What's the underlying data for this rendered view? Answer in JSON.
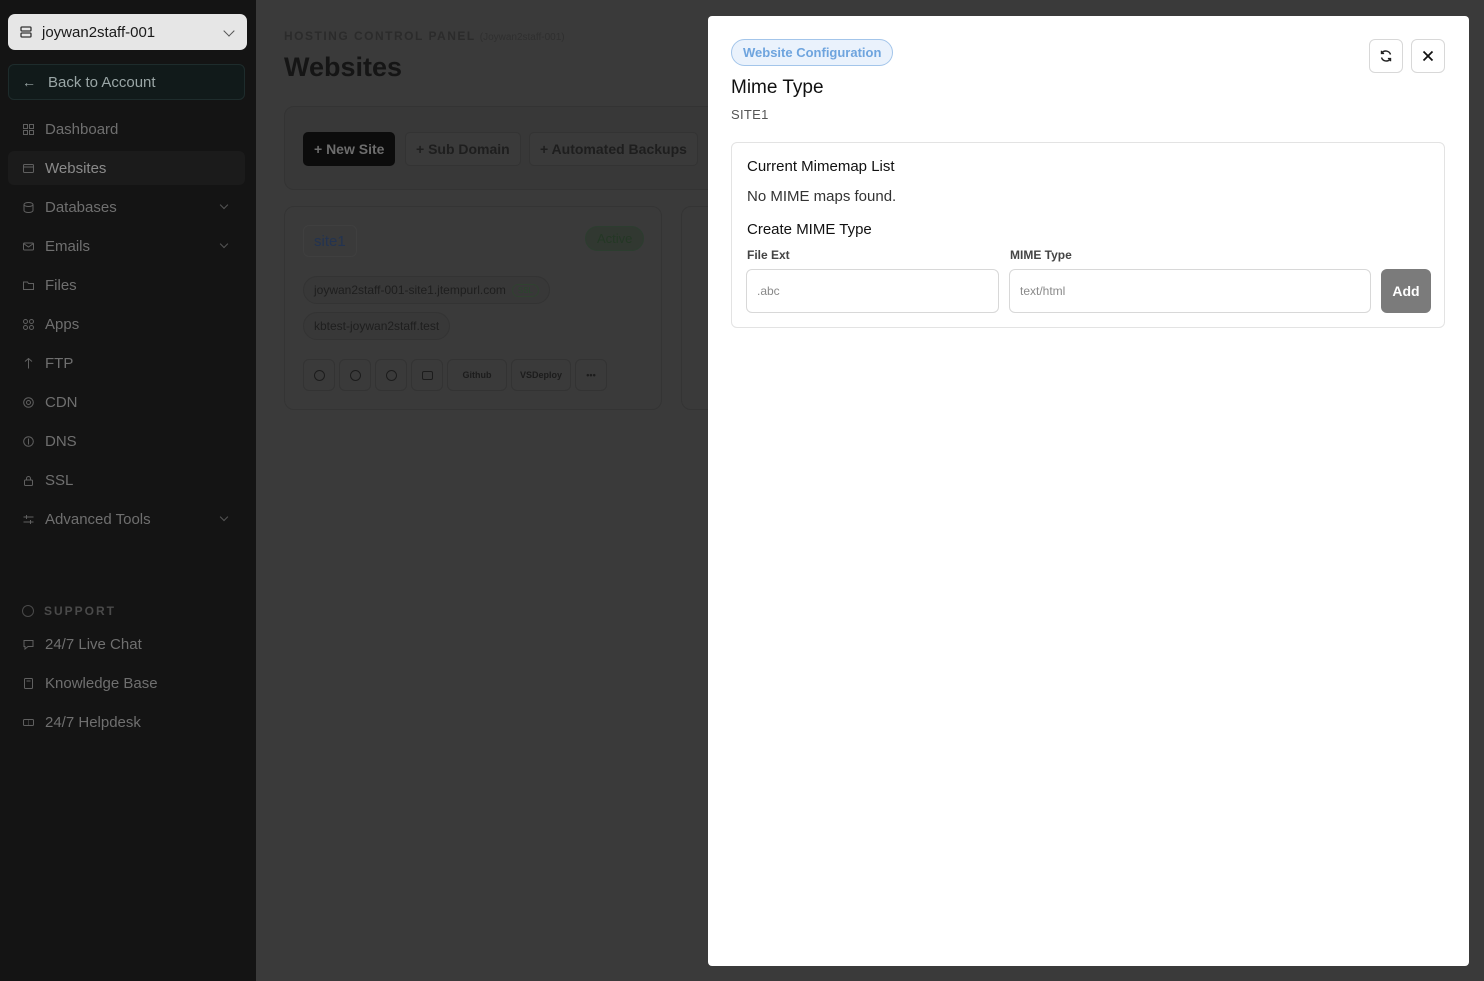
{
  "sidebar": {
    "account": "joywan2staff-001",
    "back_label": "Back to Account",
    "items": [
      {
        "label": "Dashboard"
      },
      {
        "label": "Websites"
      },
      {
        "label": "Databases"
      },
      {
        "label": "Emails"
      },
      {
        "label": "Files"
      },
      {
        "label": "Apps"
      },
      {
        "label": "FTP"
      },
      {
        "label": "CDN"
      },
      {
        "label": "DNS"
      },
      {
        "label": "SSL"
      },
      {
        "label": "Advanced Tools"
      }
    ],
    "support_label": "SUPPORT",
    "support_items": [
      {
        "label": "24/7 Live Chat"
      },
      {
        "label": "Knowledge Base"
      },
      {
        "label": "24/7 Helpdesk"
      }
    ]
  },
  "main": {
    "panel_label": "HOSTING CONTROL PANEL",
    "panel_sub": "(Joywan2staff-001)",
    "title": "Websites",
    "toolbar": {
      "new_site": "+ New Site",
      "sub_domain": "+ Sub Domain",
      "automated_backups": "+ Automated Backups"
    },
    "site_card": {
      "name": "site1",
      "status": "Active",
      "domains": [
        {
          "name": "joywan2staff-001-site1.jtempurl.com",
          "badge": "SSL"
        },
        {
          "name": "kbtest-joywan2staff.test",
          "badge": ""
        }
      ],
      "actions": {
        "github": "Github",
        "vsdeploy": "VSDeploy",
        "more": "•••"
      }
    }
  },
  "modal": {
    "tag": "Website Configuration",
    "title": "Mime Type",
    "subtitle": "SITE1",
    "list_heading": "Current Mimemap List",
    "empty_message": "No MIME maps found.",
    "create_heading": "Create MIME Type",
    "file_ext_label": "File Ext",
    "file_ext_placeholder": ".abc",
    "mime_type_label": "MIME Type",
    "mime_type_placeholder": "text/html",
    "add_label": "Add"
  }
}
